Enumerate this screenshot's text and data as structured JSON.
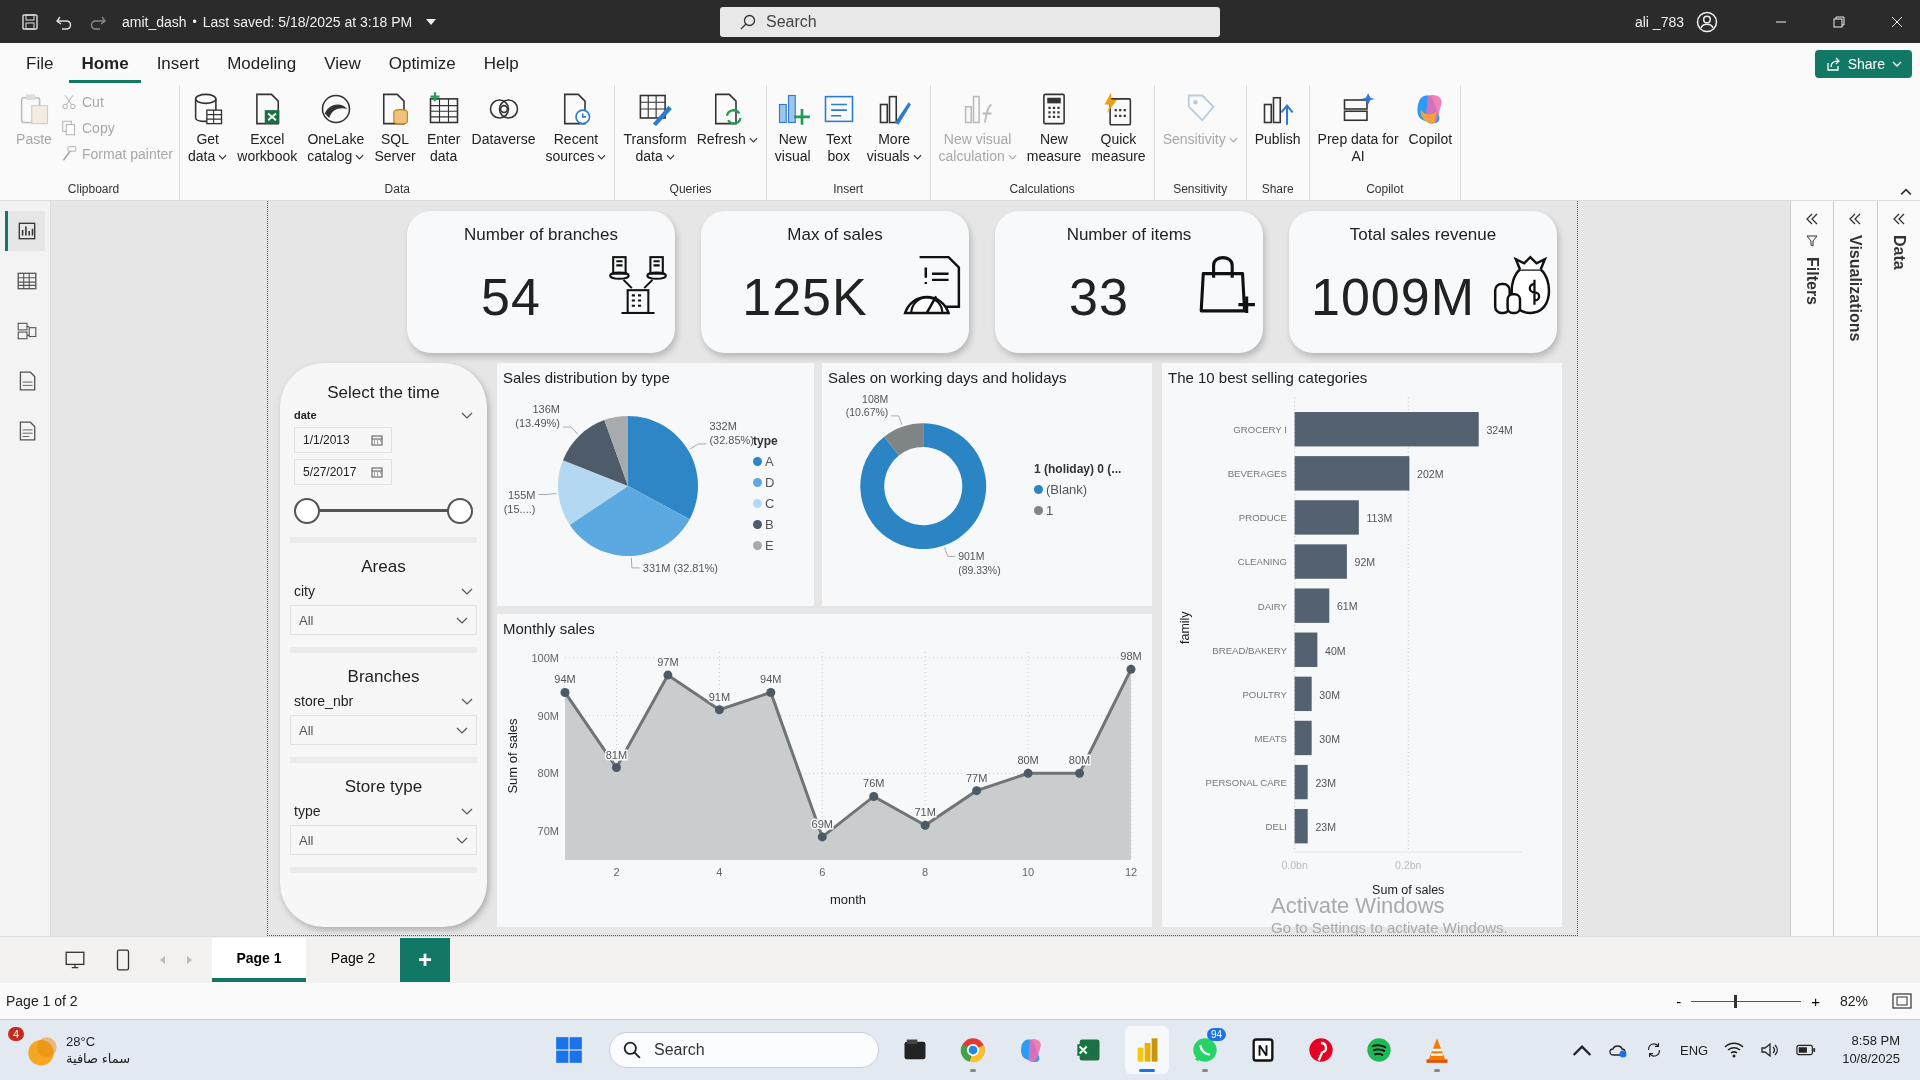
{
  "title_bar": {
    "file_name": "amit_dash",
    "separator": "•",
    "saved": "Last saved: 5/18/2025 at 3:18 PM",
    "search": {
      "placeholder": "Search"
    },
    "user": "ali _783"
  },
  "menu_tabs": [
    {
      "label": "File",
      "selected": false
    },
    {
      "label": "Home",
      "selected": true
    },
    {
      "label": "Insert",
      "selected": false
    },
    {
      "label": "Modeling",
      "selected": false
    },
    {
      "label": "View",
      "selected": false
    },
    {
      "label": "Optimize",
      "selected": false
    },
    {
      "label": "Help",
      "selected": false
    }
  ],
  "share_button": "Share",
  "ribbon": {
    "groups": [
      {
        "name": "Clipboard",
        "buttons": [
          {
            "kind": "large",
            "label": "Paste",
            "disabled": true,
            "dropdown": false
          },
          {
            "kind": "small",
            "label": "Cut",
            "disabled": true
          },
          {
            "kind": "small",
            "label": "Copy",
            "disabled": true
          },
          {
            "kind": "small",
            "label": "Format painter",
            "disabled": true
          }
        ]
      },
      {
        "name": "Data",
        "buttons": [
          {
            "kind": "large",
            "label": "Get\ndata",
            "disabled": false,
            "dropdown": true
          },
          {
            "kind": "large",
            "label": "Excel\nworkbook",
            "disabled": false,
            "dropdown": false
          },
          {
            "kind": "large",
            "label": "OneLake\ncatalog",
            "disabled": false,
            "dropdown": true
          },
          {
            "kind": "large",
            "label": "SQL\nServer",
            "disabled": false,
            "dropdown": false
          },
          {
            "kind": "large",
            "label": "Enter\ndata",
            "disabled": false,
            "dropdown": false
          },
          {
            "kind": "large",
            "label": "Dataverse",
            "disabled": false,
            "dropdown": false
          },
          {
            "kind": "large",
            "label": "Recent\nsources",
            "disabled": false,
            "dropdown": true
          }
        ]
      },
      {
        "name": "Queries",
        "buttons": [
          {
            "kind": "large",
            "label": "Transform\ndata",
            "disabled": false,
            "dropdown": true
          },
          {
            "kind": "large",
            "label": "Refresh",
            "disabled": false,
            "dropdown": true
          }
        ]
      },
      {
        "name": "Insert",
        "buttons": [
          {
            "kind": "large",
            "label": "New\nvisual",
            "disabled": false,
            "dropdown": false
          },
          {
            "kind": "large",
            "label": "Text\nbox",
            "disabled": false,
            "dropdown": false
          },
          {
            "kind": "large",
            "label": "More\nvisuals",
            "disabled": false,
            "dropdown": true
          }
        ]
      },
      {
        "name": "Calculations",
        "buttons": [
          {
            "kind": "large",
            "label": "New visual\ncalculation",
            "disabled": true,
            "dropdown": true
          },
          {
            "kind": "large",
            "label": "New\nmeasure",
            "disabled": false,
            "dropdown": false
          },
          {
            "kind": "large",
            "label": "Quick\nmeasure",
            "disabled": false,
            "dropdown": false
          }
        ]
      },
      {
        "name": "Sensitivity",
        "buttons": [
          {
            "kind": "large",
            "label": "Sensitivity",
            "disabled": true,
            "dropdown": true
          }
        ]
      },
      {
        "name": "Share",
        "buttons": [
          {
            "kind": "large",
            "label": "Publish",
            "disabled": false,
            "dropdown": false
          }
        ]
      },
      {
        "name": "Copilot",
        "buttons": [
          {
            "kind": "large",
            "label": "Prep data for\nAI",
            "disabled": false,
            "dropdown": false
          },
          {
            "kind": "large",
            "label": "Copilot",
            "disabled": false,
            "dropdown": false
          }
        ]
      }
    ]
  },
  "view_rail": [
    {
      "selected": true
    },
    {
      "selected": false
    },
    {
      "selected": false
    },
    {
      "selected": false
    },
    {
      "selected": false
    }
  ],
  "kpi_cards": [
    {
      "title": "Number of branches",
      "value": "54"
    },
    {
      "title": "Max of sales",
      "value": "125K"
    },
    {
      "title": "Number of items",
      "value": "33"
    },
    {
      "title": "Total sales revenue",
      "value": "1009M"
    }
  ],
  "slicers": [
    {
      "kind": "date_range",
      "title": "Select the time",
      "field": "date",
      "start": "1/1/2013",
      "end": "5/27/2017",
      "range": {
        "from": {
          "level": 0
        },
        "to": {
          "level": 1
        }
      }
    },
    {
      "kind": "dropdown",
      "title": "Areas",
      "field": "city",
      "value": "All"
    },
    {
      "kind": "dropdown",
      "title": "Branches",
      "field": "store_nbr",
      "value": "All"
    },
    {
      "kind": "dropdown",
      "title": "Store type",
      "field": "type",
      "value": "All"
    }
  ],
  "pie_card": {
    "slice_colors": [
      {
        "color": "#2f86c6"
      },
      {
        "color": "#5ba9e0"
      },
      {
        "color": "#b5d8f2"
      },
      {
        "color": "#4e5b6b"
      },
      {
        "color": "#a7abb0"
      }
    ],
    "chart_data": {
      "type": "pie",
      "title": "Sales distribution by type",
      "categories": [
        "A",
        "D",
        "C",
        "B",
        "E"
      ],
      "series": [
        {
          "name": "type",
          "values": [
            32.85,
            32.81,
            15.36,
            13.49,
            5.49
          ]
        }
      ],
      "legend": "right",
      "value_labels": [
        "332M\n(32.85%)",
        "331M (32.81%)",
        "155M\n(15....)",
        "136M\n(13.49%)",
        null
      ]
    }
  },
  "donut_card": {
    "slice_colors": [
      {
        "color": "#2b85c4"
      },
      {
        "color": "#7f8585"
      }
    ],
    "chart_data": {
      "type": "donut",
      "title": "Sales on working days and holidays",
      "categories": [
        "(Blank)",
        "1"
      ],
      "series": [
        {
          "name": "1 (holiday) 0 (...",
          "values": [
            89.33,
            10.67
          ]
        }
      ],
      "legend": "right",
      "value_labels": [
        "901M\n(89.33%)",
        "108M\n(10.67%)"
      ]
    }
  },
  "line_card": {
    "chart_data": {
      "type": "area",
      "title": "Monthly sales",
      "xlabel": "month",
      "ylabel": "Sum of sales",
      "x": [
        1,
        2,
        3,
        4,
        5,
        6,
        7,
        8,
        9,
        10,
        11,
        12
      ],
      "series": [
        {
          "color": "#6f7474",
          "values": [
            94,
            81,
            97,
            91,
            94,
            69,
            76,
            71,
            77,
            80,
            80,
            98
          ]
        }
      ],
      "grid": true,
      "xlim": [
        1,
        12
      ],
      "ylim": [
        65,
        101
      ],
      "xticks": [
        2,
        4,
        6,
        8,
        10,
        12
      ],
      "yticks": [
        {
          "value": 70,
          "label": "70M"
        },
        {
          "value": 80,
          "label": "80M"
        },
        {
          "value": 90,
          "label": "90M"
        },
        {
          "value": 100,
          "label": "100M"
        }
      ],
      "value_labels": [
        "94M",
        "81M",
        "97M",
        "91M",
        "94M",
        "69M",
        "76M",
        "71M",
        "77M",
        "80M",
        "80M",
        "98M"
      ]
    }
  },
  "bar_card": {
    "chart_data": {
      "type": "bar",
      "orientation": "horizontal",
      "title": "The 10 best selling categories",
      "xlabel": "Sum of sales",
      "ylabel": "family",
      "categories": [
        "GROCERY I",
        "BEVERAGES",
        "PRODUCE",
        "CLEANING",
        "DAIRY",
        "BREAD/BAKERY",
        "POULTRY",
        "MEATS",
        "PERSONAL CARE",
        "DELI"
      ],
      "series": [
        {
          "color": "#536170",
          "values": [
            0.324,
            0.202,
            0.113,
            0.092,
            0.061,
            0.04,
            0.03,
            0.03,
            0.023,
            0.023
          ]
        }
      ],
      "xlim": [
        0,
        0.4
      ],
      "xticks": [
        {
          "value": 0,
          "label": "0.0bn"
        },
        {
          "value": 0.2,
          "label": "0.2bn"
        }
      ],
      "value_labels": [
        "324M",
        "202M",
        "113M",
        "92M",
        "61M",
        "40M",
        "30M",
        "30M",
        "23M",
        "23M"
      ]
    }
  },
  "side_panes": [
    {
      "label": "Filters"
    },
    {
      "label": "Visualizations"
    },
    {
      "label": "Data"
    }
  ],
  "activation_notice": {
    "title": "Activate Windows",
    "text": "Go to Settings to activate Windows."
  },
  "page_tabs": [
    {
      "label": "Page 1",
      "selected": true
    },
    {
      "label": "Page 2",
      "selected": false
    }
  ],
  "add_page": "+",
  "status_bar": {
    "page_info": "Page 1 of 2",
    "zoom": {
      "minus": "-",
      "plus": "+",
      "level": 0.4,
      "value": "82%"
    }
  },
  "taskbar": {
    "weather": {
      "badge": "4",
      "temp": "28°C",
      "condition": "سماء صافية"
    },
    "search": {
      "placeholder": "Search"
    },
    "apps": [
      {
        "selected": false,
        "running": false
      },
      {
        "selected": false,
        "running": true
      },
      {
        "selected": false,
        "running": false
      },
      {
        "selected": false,
        "running": false
      },
      {
        "selected": true,
        "running": true
      },
      {
        "selected": false,
        "running": true,
        "badge": "94"
      },
      {
        "selected": false,
        "running": false
      },
      {
        "selected": false,
        "running": false
      },
      {
        "selected": false,
        "running": false
      },
      {
        "selected": false,
        "running": true
      }
    ],
    "language": "ENG",
    "time": "8:58 PM",
    "date": "10/8/2025"
  }
}
